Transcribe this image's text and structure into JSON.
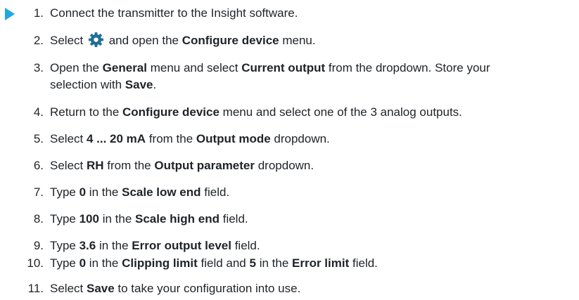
{
  "colors": {
    "marker": "#1ea8df",
    "text": "#1f2328",
    "gear_icon": "#1f6f96"
  },
  "icons": {
    "marker": "play-triangle-icon",
    "settings": "gear-icon"
  },
  "steps": [
    {
      "num": "1.",
      "line1": [
        {
          "t": "Connect the transmitter to the Insight software.",
          "b": false
        }
      ]
    },
    {
      "num": "2.",
      "line1a": [
        {
          "t": "Select",
          "b": false
        }
      ],
      "line1b": [
        {
          "t": "and open the ",
          "b": false
        },
        {
          "t": "Configure device",
          "b": true
        },
        {
          "t": " menu.",
          "b": false
        }
      ]
    },
    {
      "num": "3.",
      "line1": [
        {
          "t": "Open the ",
          "b": false
        },
        {
          "t": "General",
          "b": true
        },
        {
          "t": " menu and select ",
          "b": false
        },
        {
          "t": "Current output",
          "b": true
        },
        {
          "t": " from the dropdown. Store your",
          "b": false
        }
      ],
      "line2": [
        {
          "t": "selection with ",
          "b": false
        },
        {
          "t": "Save",
          "b": true
        },
        {
          "t": ".",
          "b": false
        }
      ]
    },
    {
      "num": "4.",
      "line1": [
        {
          "t": "Return to the ",
          "b": false
        },
        {
          "t": "Configure device",
          "b": true
        },
        {
          "t": " menu and select one of the 3 analog outputs.",
          "b": false
        }
      ]
    },
    {
      "num": "5.",
      "line1": [
        {
          "t": "Select ",
          "b": false
        },
        {
          "t": "4 ... 20 mA",
          "b": true
        },
        {
          "t": " from the ",
          "b": false
        },
        {
          "t": "Output mode",
          "b": true
        },
        {
          "t": " dropdown.",
          "b": false
        }
      ]
    },
    {
      "num": "6.",
      "line1": [
        {
          "t": "Select ",
          "b": false
        },
        {
          "t": "RH",
          "b": true
        },
        {
          "t": " from the ",
          "b": false
        },
        {
          "t": "Output parameter",
          "b": true
        },
        {
          "t": " dropdown.",
          "b": false
        }
      ]
    },
    {
      "num": "7.",
      "line1": [
        {
          "t": "Type ",
          "b": false
        },
        {
          "t": "0",
          "b": true
        },
        {
          "t": " in the ",
          "b": false
        },
        {
          "t": "Scale low end",
          "b": true
        },
        {
          "t": " field.",
          "b": false
        }
      ]
    },
    {
      "num": "8.",
      "line1": [
        {
          "t": "Type ",
          "b": false
        },
        {
          "t": "100",
          "b": true
        },
        {
          "t": " in the ",
          "b": false
        },
        {
          "t": "Scale high end",
          "b": true
        },
        {
          "t": " field.",
          "b": false
        }
      ]
    },
    {
      "num": "9.",
      "line1": [
        {
          "t": "Type ",
          "b": false
        },
        {
          "t": "3.6",
          "b": true
        },
        {
          "t": " in the ",
          "b": false
        },
        {
          "t": "Error output level",
          "b": true
        },
        {
          "t": " field.",
          "b": false
        }
      ]
    },
    {
      "num": "10.",
      "line1": [
        {
          "t": "Type ",
          "b": false
        },
        {
          "t": "0",
          "b": true
        },
        {
          "t": " in the ",
          "b": false
        },
        {
          "t": "Clipping limit",
          "b": true
        },
        {
          "t": " field and ",
          "b": false
        },
        {
          "t": "5",
          "b": true
        },
        {
          "t": " in the ",
          "b": false
        },
        {
          "t": "Error limit",
          "b": true
        },
        {
          "t": " field.",
          "b": false
        }
      ]
    },
    {
      "num": "11.",
      "line1": [
        {
          "t": "Select ",
          "b": false
        },
        {
          "t": "Save",
          "b": true
        },
        {
          "t": " to take your configuration into use.",
          "b": false
        }
      ]
    }
  ]
}
